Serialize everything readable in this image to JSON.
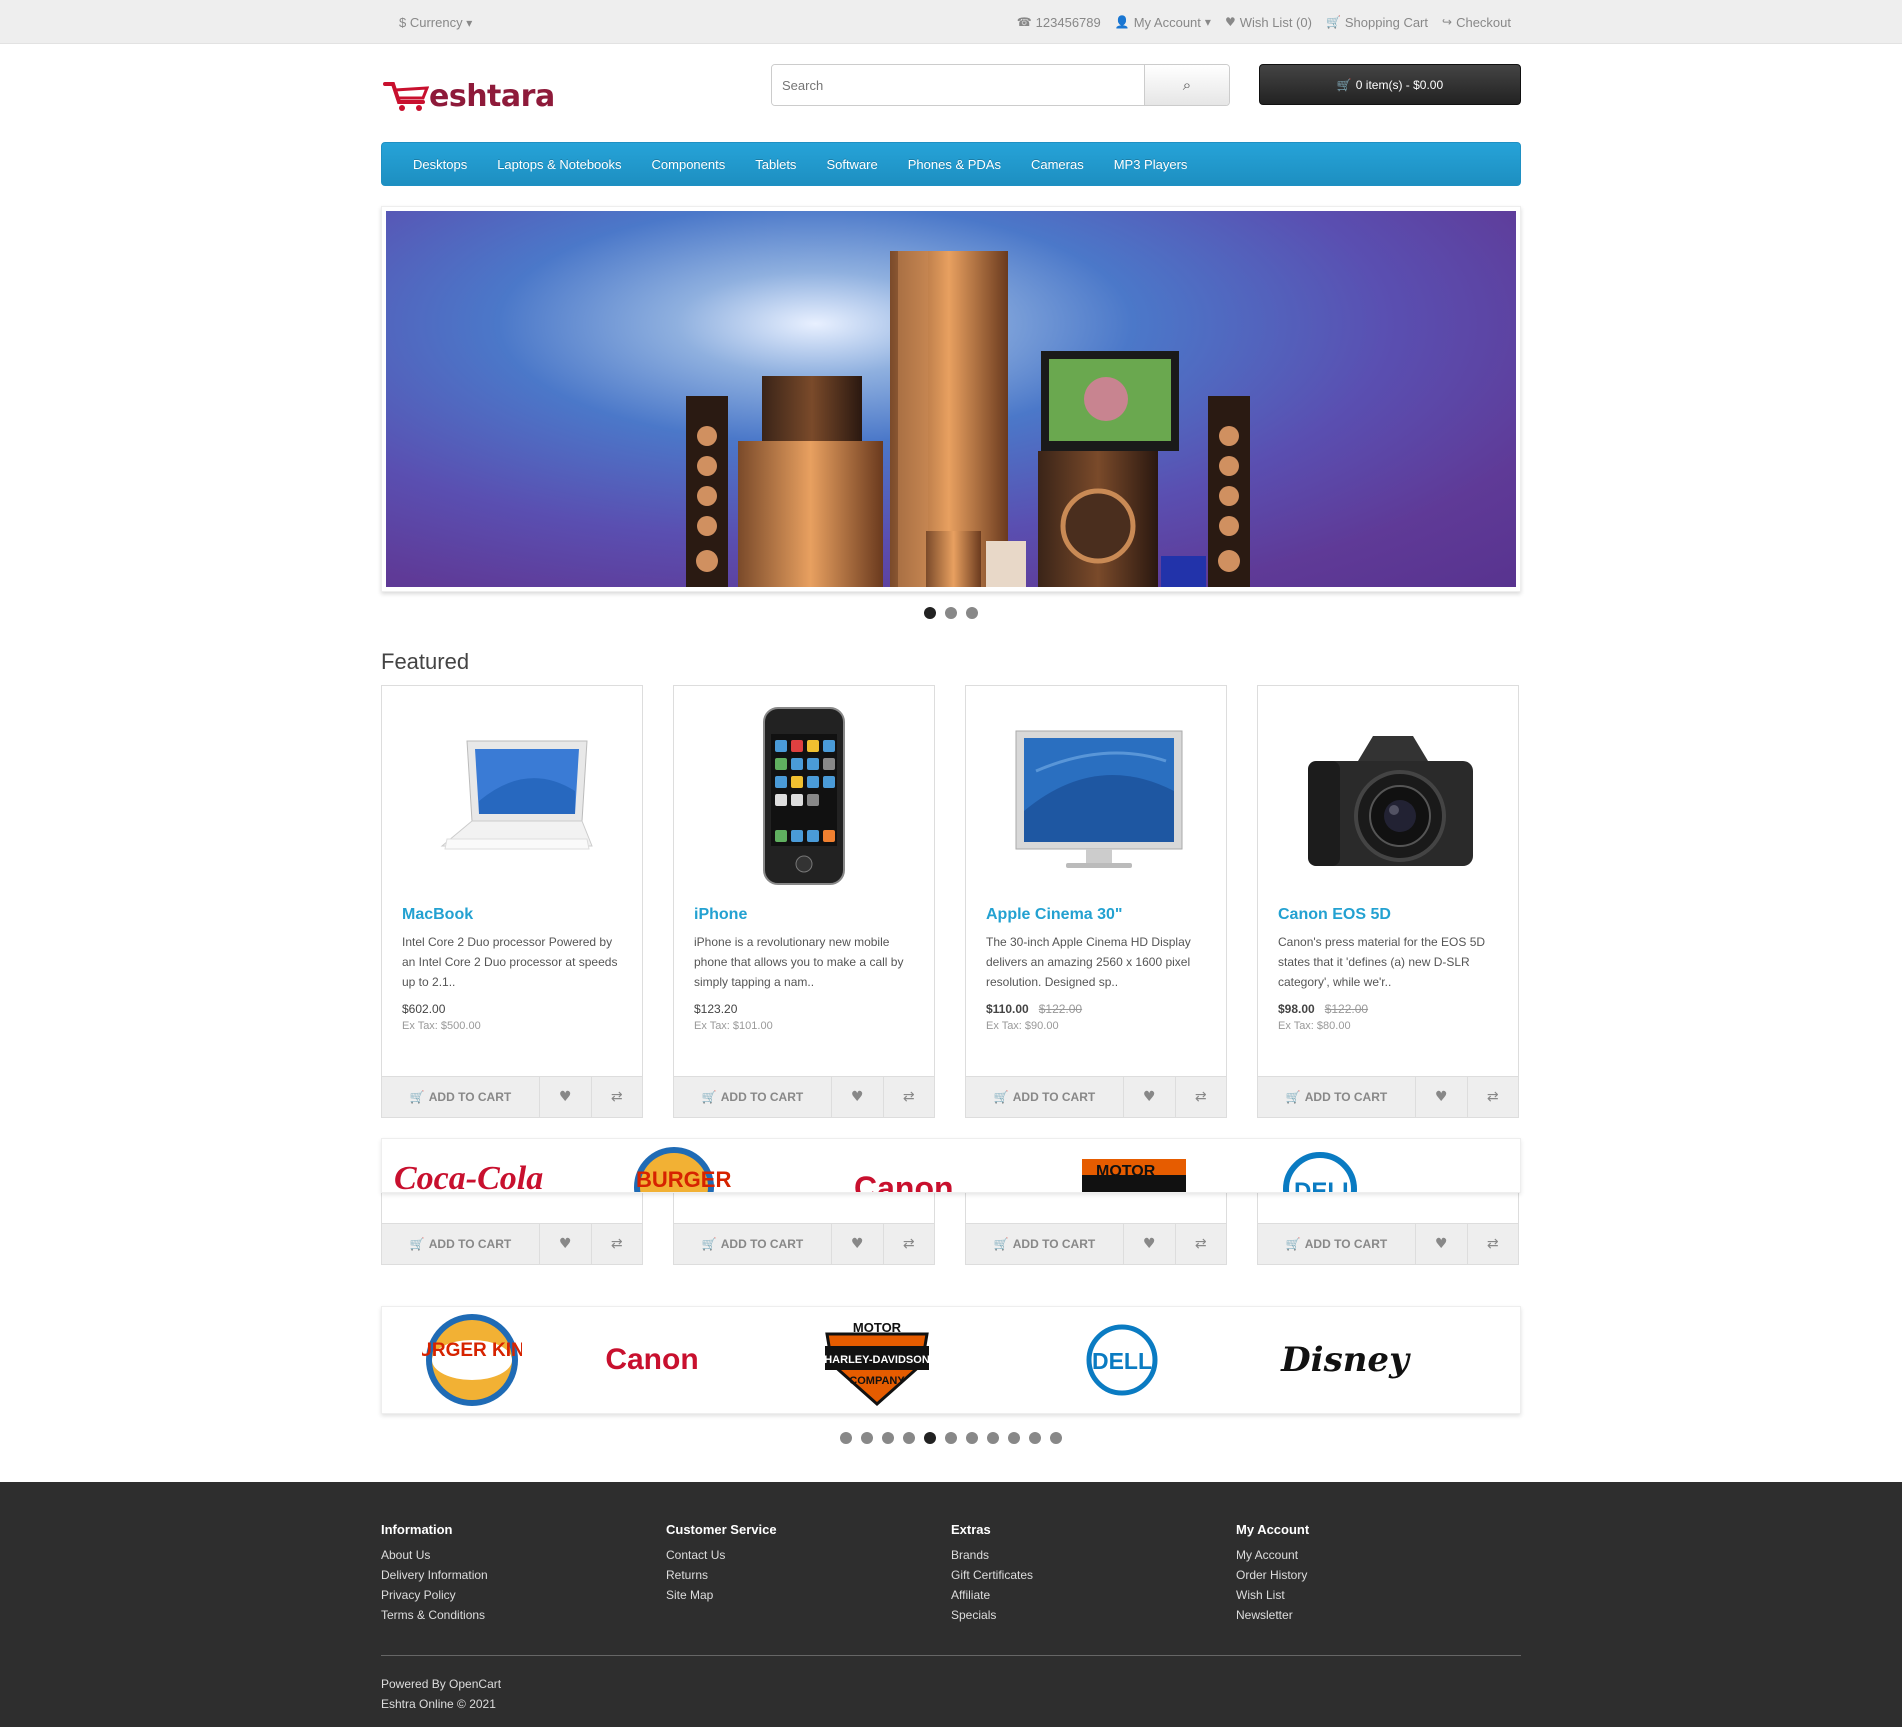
{
  "topbar": {
    "currency": "$ Currency",
    "phone": "123456789",
    "my_account": "My Account",
    "wish_list": "Wish List (0)",
    "shopping_cart": "Shopping Cart",
    "checkout": "Checkout"
  },
  "header": {
    "logo_text": "eshtara",
    "search_placeholder": "Search",
    "cart_label": "0 item(s) - $0.00"
  },
  "menu": [
    "Desktops",
    "Laptops & Notebooks",
    "Components",
    "Tablets",
    "Software",
    "Phones & PDAs",
    "Cameras",
    "MP3 Players"
  ],
  "featured": {
    "title": "Featured",
    "add_to_cart": "ADD TO CART",
    "products": [
      {
        "name": "MacBook",
        "desc": "Intel Core 2 Duo processor Powered by an Intel Core 2 Duo processor at speeds up to 2.1..",
        "price": "$602.00",
        "old_price": "",
        "extax": "Ex Tax: $500.00"
      },
      {
        "name": "iPhone",
        "desc": "iPhone is a revolutionary new mobile phone that allows you to make a call by simply tapping a nam..",
        "price": "$123.20",
        "old_price": "",
        "extax": "Ex Tax: $101.00"
      },
      {
        "name": "Apple Cinema 30\"",
        "desc": "The 30-inch Apple Cinema HD Display delivers an amazing 2560 x 1600 pixel resolution. Designed sp..",
        "price": "$110.00",
        "old_price": "$122.00",
        "extax": "Ex Tax: $90.00"
      },
      {
        "name": "Canon EOS 5D",
        "desc": "Canon's press material for the EOS 5D states that it 'defines (a) new D-SLR category', while we'r..",
        "price": "$98.00",
        "old_price": "$122.00",
        "extax": "Ex Tax: $80.00"
      }
    ]
  },
  "brands": [
    "BURGER KING",
    "Canon",
    "HARLEY-DAVIDSON",
    "DELL",
    "Disney"
  ],
  "footer": {
    "columns": [
      {
        "title": "Information",
        "links": [
          "About Us",
          "Delivery Information",
          "Privacy Policy",
          "Terms & Conditions"
        ]
      },
      {
        "title": "Customer Service",
        "links": [
          "Contact Us",
          "Returns",
          "Site Map"
        ]
      },
      {
        "title": "Extras",
        "links": [
          "Brands",
          "Gift Certificates",
          "Affiliate",
          "Specials"
        ]
      },
      {
        "title": "My Account",
        "links": [
          "My Account",
          "Order History",
          "Wish List",
          "Newsletter"
        ]
      }
    ],
    "powered_prefix": "Powered By ",
    "powered_link": "OpenCart",
    "copyright": "Eshtra Online © 2021"
  },
  "colors": {
    "menu": "#229ac8",
    "link": "#23a1d1",
    "logo": "#8e1a3a",
    "footer_bg": "#2e2e2e"
  }
}
